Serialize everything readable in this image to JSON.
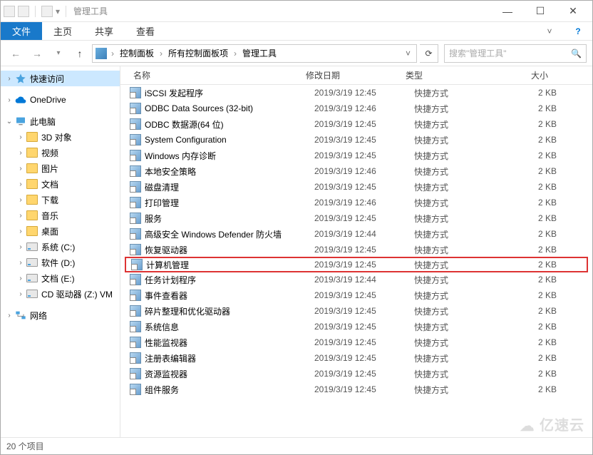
{
  "titlebar": {
    "title": "管理工具"
  },
  "window_controls": {
    "min": "—",
    "max": "☐",
    "close": "✕"
  },
  "ribbon": {
    "file": "文件",
    "home": "主页",
    "share": "共享",
    "view": "查看"
  },
  "nav": {
    "breadcrumb": [
      "控制面板",
      "所有控制面板项",
      "管理工具"
    ],
    "search_placeholder": "搜索\"管理工具\""
  },
  "sidebar": {
    "quick": "快速访问",
    "onedrive": "OneDrive",
    "thispc": "此电脑",
    "pc_children": [
      "3D 对象",
      "视频",
      "图片",
      "文档",
      "下载",
      "音乐",
      "桌面",
      "系统 (C:)",
      "软件 (D:)",
      "文档 (E:)",
      "CD 驱动器 (Z:) VM"
    ],
    "network": "网络"
  },
  "columns": {
    "name": "名称",
    "date": "修改日期",
    "type": "类型",
    "size": "大小"
  },
  "files": [
    {
      "name": "iSCSI 发起程序",
      "date": "2019/3/19 12:45",
      "type": "快捷方式",
      "size": "2 KB"
    },
    {
      "name": "ODBC Data Sources (32-bit)",
      "date": "2019/3/19 12:46",
      "type": "快捷方式",
      "size": "2 KB"
    },
    {
      "name": "ODBC 数据源(64 位)",
      "date": "2019/3/19 12:45",
      "type": "快捷方式",
      "size": "2 KB"
    },
    {
      "name": "System Configuration",
      "date": "2019/3/19 12:45",
      "type": "快捷方式",
      "size": "2 KB"
    },
    {
      "name": "Windows 内存诊断",
      "date": "2019/3/19 12:45",
      "type": "快捷方式",
      "size": "2 KB"
    },
    {
      "name": "本地安全策略",
      "date": "2019/3/19 12:46",
      "type": "快捷方式",
      "size": "2 KB"
    },
    {
      "name": "磁盘清理",
      "date": "2019/3/19 12:45",
      "type": "快捷方式",
      "size": "2 KB"
    },
    {
      "name": "打印管理",
      "date": "2019/3/19 12:46",
      "type": "快捷方式",
      "size": "2 KB"
    },
    {
      "name": "服务",
      "date": "2019/3/19 12:45",
      "type": "快捷方式",
      "size": "2 KB"
    },
    {
      "name": "高级安全 Windows Defender 防火墙",
      "date": "2019/3/19 12:44",
      "type": "快捷方式",
      "size": "2 KB"
    },
    {
      "name": "恢复驱动器",
      "date": "2019/3/19 12:45",
      "type": "快捷方式",
      "size": "2 KB"
    },
    {
      "name": "计算机管理",
      "date": "2019/3/19 12:45",
      "type": "快捷方式",
      "size": "2 KB",
      "highlight": true
    },
    {
      "name": "任务计划程序",
      "date": "2019/3/19 12:44",
      "type": "快捷方式",
      "size": "2 KB"
    },
    {
      "name": "事件查看器",
      "date": "2019/3/19 12:45",
      "type": "快捷方式",
      "size": "2 KB"
    },
    {
      "name": "碎片整理和优化驱动器",
      "date": "2019/3/19 12:45",
      "type": "快捷方式",
      "size": "2 KB"
    },
    {
      "name": "系统信息",
      "date": "2019/3/19 12:45",
      "type": "快捷方式",
      "size": "2 KB"
    },
    {
      "name": "性能监视器",
      "date": "2019/3/19 12:45",
      "type": "快捷方式",
      "size": "2 KB"
    },
    {
      "name": "注册表编辑器",
      "date": "2019/3/19 12:45",
      "type": "快捷方式",
      "size": "2 KB"
    },
    {
      "name": "资源监视器",
      "date": "2019/3/19 12:45",
      "type": "快捷方式",
      "size": "2 KB"
    },
    {
      "name": "组件服务",
      "date": "2019/3/19 12:45",
      "type": "快捷方式",
      "size": "2 KB"
    }
  ],
  "status": {
    "count": "20 个项目"
  },
  "watermark": "亿速云"
}
